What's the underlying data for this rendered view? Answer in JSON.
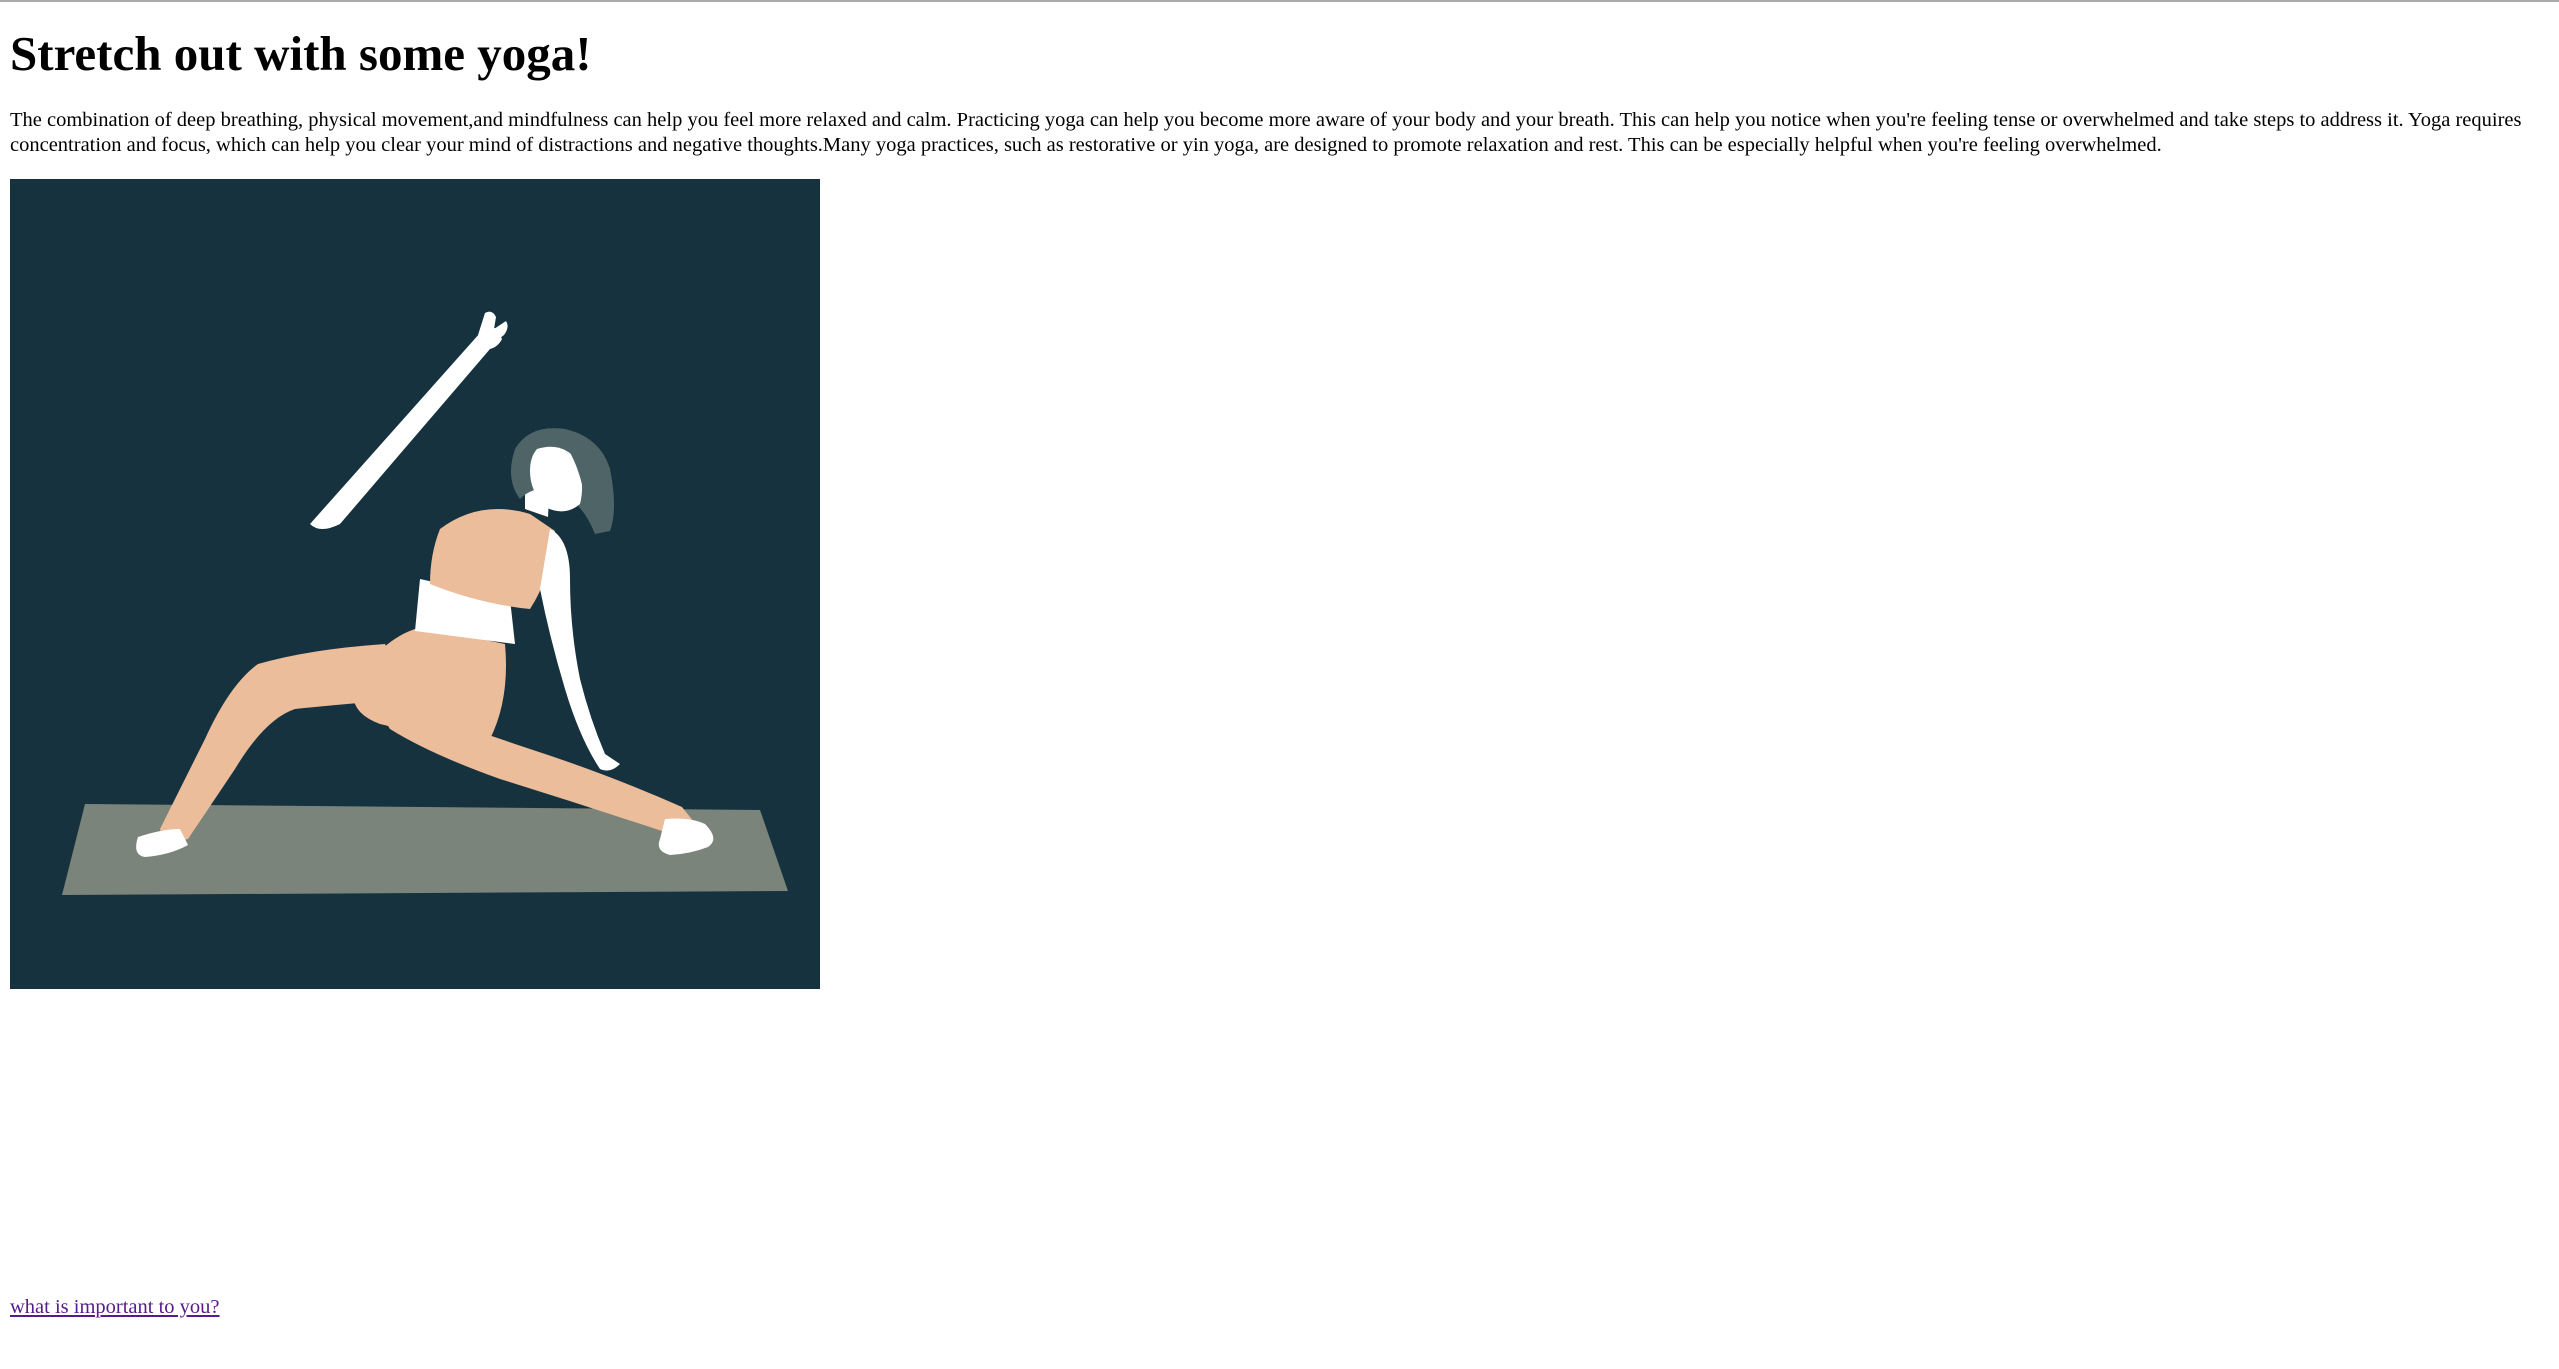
{
  "heading": "Stretch out with some yoga!",
  "paragraph": "The combination of deep breathing, physical movement,and mindfulness can help you feel more relaxed and calm. Practicing yoga can help you become more aware of your body and your breath. This can help you notice when you're feeling tense or overwhelmed and take steps to address it. Yoga requires concentration and focus, which can help you clear your mind of distractions and negative thoughts.Many yoga practices, such as restorative or yin yoga, are designed to promote relaxation and rest. This can be especially helpful when you're feeling overwhelmed.",
  "link": {
    "label": "what is important to you?"
  },
  "colors": {
    "background": "#17323f",
    "skin": "#ffffff",
    "clothing": "#ebbd9a",
    "hair": "#4f6467",
    "mat": "#7a847a",
    "link_visited": "#551a8b"
  }
}
